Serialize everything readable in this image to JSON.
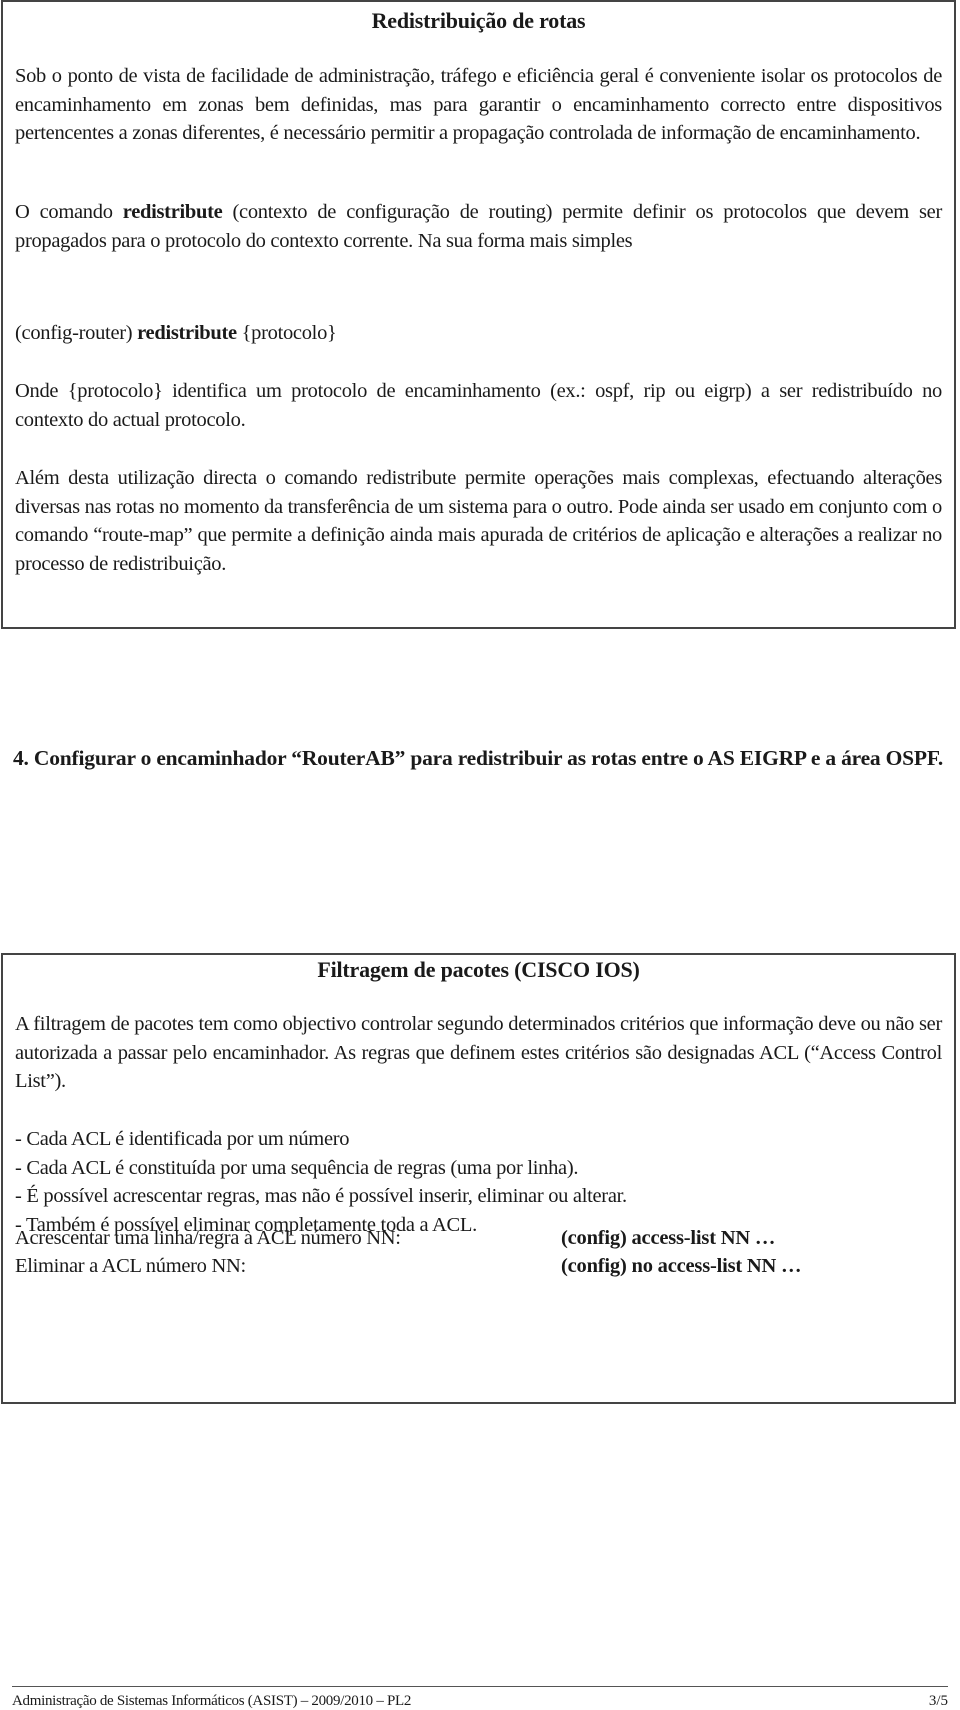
{
  "section1": {
    "title": "Redistribuição de rotas",
    "p1": "Sob o ponto de vista de facilidade de administração, tráfego e eficiência geral é conveniente isolar os protocolos de encaminhamento em zonas bem definidas, mas para garantir o encaminhamento correcto entre dispositivos pertencentes a zonas diferentes, é necessário permitir a propagação controlada de informação de encaminhamento.",
    "p2_pre": "O comando ",
    "p2_bold": "redistribute",
    "p2_post": " (contexto de configuração de routing) permite definir os protocolos que devem ser propagados para o protocolo do contexto corrente. Na sua forma mais simples",
    "syntax_pre": "(config-router) ",
    "syntax_bold": "redistribute",
    "syntax_post": " {protocolo}",
    "p3": "Onde {protocolo} identifica um protocolo de encaminhamento (ex.: ospf, rip ou eigrp) a ser redistribuído no contexto do actual protocolo.",
    "p4": "Além desta utilização directa o comando redistribute permite operações mais complexas, efectuando alterações diversas nas rotas no momento da transferência de um sistema para o outro. Pode ainda ser usado em conjunto com o comando “route-map” que permite a definição ainda mais apurada de critérios de aplicação e alterações a realizar no processo de redistribuição."
  },
  "question": {
    "text": "4. Configurar o encaminhador “RouterAB” para redistribuir as rotas entre o AS EIGRP e a área OSPF."
  },
  "section2": {
    "title": "Filtragem de pacotes (CISCO IOS)",
    "p1": "A filtragem de pacotes tem como objectivo controlar segundo determinados critérios que informação deve ou não ser autorizada a passar pelo encaminhador. As regras que definem estes critérios são designadas ACL (“Access Control List”).",
    "bullets": [
      "- Cada ACL é identificada por um número",
      "- Cada ACL é constituída por uma sequência de regras (uma por linha).",
      "- É possível acrescentar regras, mas não é possível inserir, eliminar ou alterar.",
      "- Também é possível eliminar completamente toda a ACL."
    ],
    "commands": [
      {
        "label": "Acrescentar uma linha/regra à ACL número NN:",
        "command": "(config) access-list NN …"
      },
      {
        "label": "Eliminar a ACL número NN:",
        "command": "(config) no access-list NN …"
      }
    ]
  },
  "footer": {
    "course": "Administração de Sistemas Informáticos (ASIST) – 2009/2010 – PL2",
    "page": "3/5"
  }
}
